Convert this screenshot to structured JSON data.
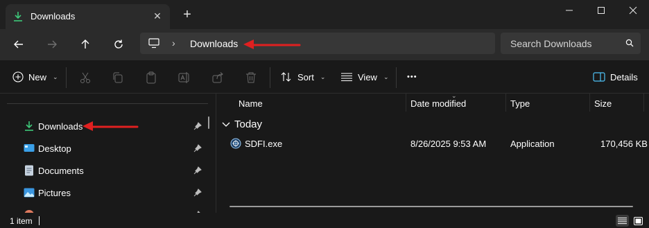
{
  "window": {
    "tab_title": "Downloads",
    "new_tab_glyph": "+",
    "close_tab_glyph": "✕"
  },
  "address_bar": {
    "location_icon": "this-pc-icon",
    "separator": "›",
    "current_folder": "Downloads",
    "search_placeholder": "Search Downloads"
  },
  "command_bar": {
    "new_label": "New",
    "sort_label": "Sort",
    "view_label": "View",
    "more_label": "•••",
    "details_label": "Details",
    "caret": "⌄"
  },
  "sidebar": {
    "items": [
      {
        "label": "Downloads",
        "icon": "download-icon",
        "pinned": true
      },
      {
        "label": "Desktop",
        "icon": "desktop-icon",
        "pinned": true
      },
      {
        "label": "Documents",
        "icon": "documents-icon",
        "pinned": true
      },
      {
        "label": "Pictures",
        "icon": "pictures-icon",
        "pinned": true
      }
    ]
  },
  "file_list": {
    "columns": [
      "Name",
      "Date modified",
      "Type",
      "Size"
    ],
    "groups": [
      {
        "label": "Today",
        "files": [
          {
            "name": "SDFI.exe",
            "date_modified": "8/26/2025 9:53 AM",
            "type": "Application",
            "size": "170,456 KB"
          }
        ]
      }
    ]
  },
  "status_bar": {
    "item_count": "1 item"
  },
  "colors": {
    "accent_green": "#3ec97a",
    "annotation_red": "#e02020",
    "background": "#191919",
    "toolbar": "#2b2b2b"
  }
}
